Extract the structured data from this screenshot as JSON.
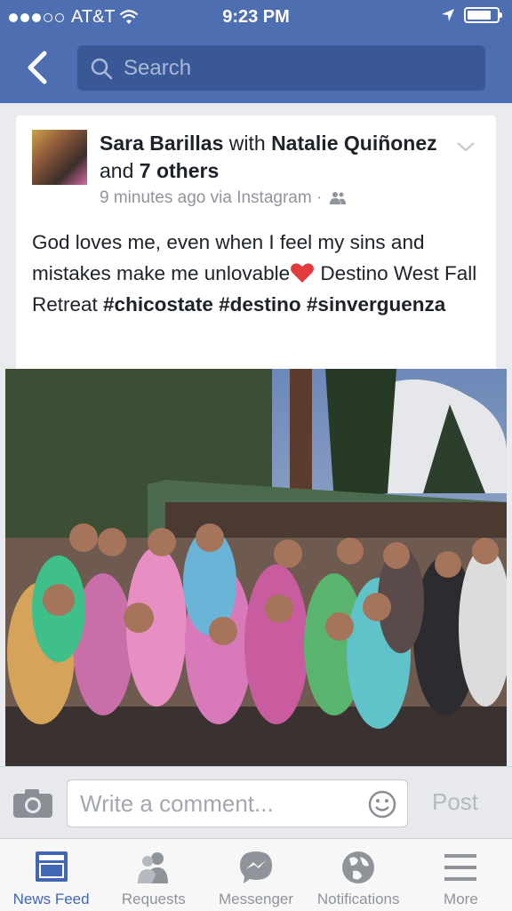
{
  "status": {
    "carrier": "AT&T",
    "time": "9:23 PM"
  },
  "search": {
    "placeholder": "Search"
  },
  "post": {
    "author": "Sara Barillas",
    "with_word": "with",
    "tagged": "Natalie Quiñonez",
    "and_word": "and",
    "others": "7 others",
    "meta": "9 minutes ago via Instagram ·",
    "text_plain": "God loves me, even when I feel my sins and mistakes make me unlovable",
    "text_after": " Destino West Fall Retreat ",
    "tag1": "#chicostate",
    "tag2": "#destino",
    "tag3": "#sinverguenza"
  },
  "comment": {
    "placeholder": "Write a comment...",
    "post_label": "Post"
  },
  "tabs": [
    {
      "label": "News Feed",
      "icon": "news-feed-icon",
      "active": true
    },
    {
      "label": "Requests",
      "icon": "requests-icon"
    },
    {
      "label": "Messenger",
      "icon": "messenger-icon"
    },
    {
      "label": "Notifications",
      "icon": "notifications-icon"
    },
    {
      "label": "More",
      "icon": "more-icon"
    }
  ],
  "colors": {
    "brand": "#4d6fb1",
    "active_tab": "#4267b2"
  }
}
